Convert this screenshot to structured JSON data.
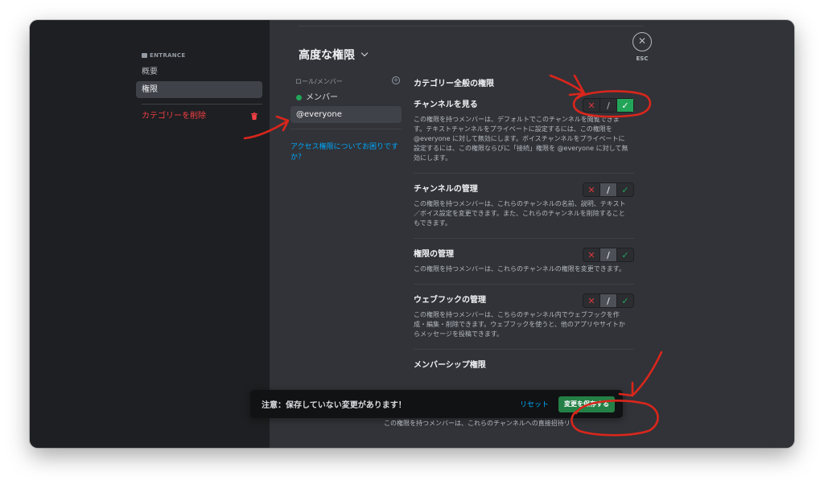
{
  "sidebar": {
    "category_header": "ENTRANCE",
    "items": [
      {
        "label": "概要",
        "active": false
      },
      {
        "label": "権限",
        "active": true
      }
    ],
    "delete_label": "カテゴリーを削除"
  },
  "header": {
    "title": "高度な権限"
  },
  "roles": {
    "header": "ロール/メンバー",
    "items": [
      {
        "label": "メンバー",
        "color": "#23a559"
      },
      {
        "label": "@everyone"
      }
    ],
    "help_link": "アクセス権限についてお困りですか？"
  },
  "permissions": {
    "section_title": "カテゴリー全般の権限",
    "items": [
      {
        "name": "チャンネルを見る",
        "description": "この権限を持つメンバーは、デフォルトでこのチャンネルを閲覧できます。テキストチャンネルをプライベートに設定するには、この権限を @everyone に対して無効にします。ボイスチャンネルをプライベートに設定するには、この権限ならびに「接続」権限を @everyone に対して無効にします。",
        "state": "allow"
      },
      {
        "name": "チャンネルの管理",
        "description": "この権限を持つメンバーは、これらのチャンネルの名前、説明、テキスト／ボイス設定を変更できます。また、これらのチャンネルを削除することもできます。",
        "state": "pass"
      },
      {
        "name": "権限の管理",
        "description": "この権限を持つメンバーは、これらのチャンネルの権限を変更できます。",
        "state": "pass"
      },
      {
        "name": "ウェブフックの管理",
        "description": "この権限を持つメンバーは、こちらのチャンネル内でウェブフックを作成・編集・削除できます。ウェブフックを使うと、他のアプリやサイトからメッセージを投稿できます。",
        "state": "pass"
      }
    ],
    "next_section_title": "メンバーシップ権限",
    "overflow_text": "この権限を持つメンバーは、これらのチャンネルへの直接招待リ",
    "toggle_glyphs": {
      "deny": "✕",
      "pass": "/",
      "allow": "✓"
    }
  },
  "close": {
    "icon": "✕",
    "label": "ESC"
  },
  "save_bar": {
    "message": "注意：保存していない変更があります！",
    "reset_label": "リセット",
    "save_label": "変更を保存する"
  },
  "colors": {
    "accent_green": "#23a559",
    "save_green": "#248046",
    "danger_red": "#f23f43",
    "link_blue": "#00a8fc",
    "annotation_red": "#d9261c"
  }
}
